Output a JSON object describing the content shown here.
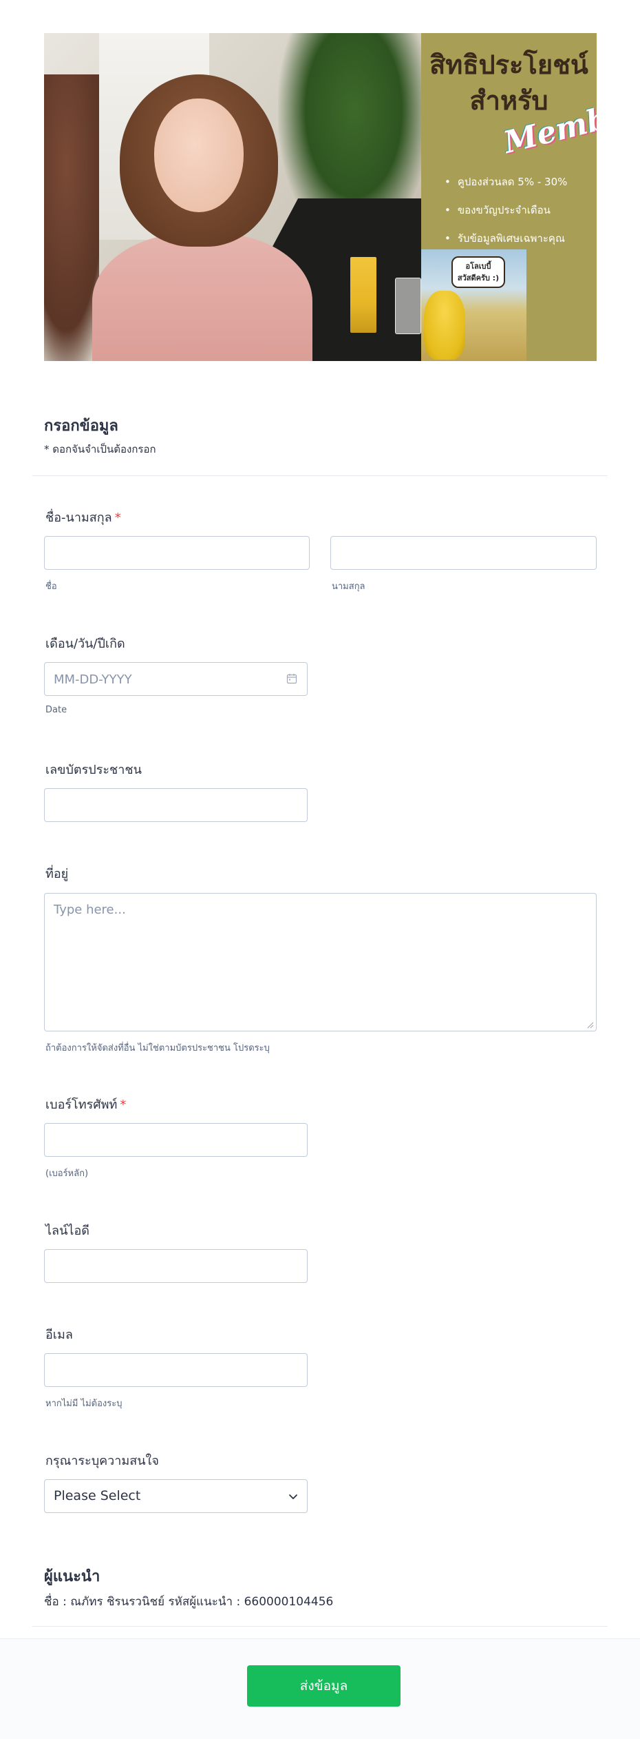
{
  "banner": {
    "title_line1": "สิทธิประโยชน์",
    "title_line2": "สำหรับ",
    "member_word": "Member",
    "benefits": [
      "คูปองส่วนลด 5% - 30%",
      "ของขวัญประจำเดือน",
      "รับข้อมูลพิเศษเฉพาะคุณ"
    ],
    "bubble_line1": "อโลเบบี้",
    "bubble_line2": "สวัสดีครับ :)"
  },
  "header": {
    "title": "กรอกข้อมูล",
    "subtitle": "* ดอกจันจำเป็นต้องกรอก"
  },
  "fields": {
    "name": {
      "label": "ชื่อ-นามสกุล",
      "required_mark": "*",
      "first_sublabel": "ชื่อ",
      "last_sublabel": "นามสกุล",
      "first_value": "",
      "last_value": ""
    },
    "birthdate": {
      "label": "เดือน/วัน/ปีเกิด",
      "placeholder": "MM-DD-YYYY",
      "sublabel": "Date"
    },
    "id_card": {
      "label": "เลขบัตรประชาชน",
      "value": ""
    },
    "address": {
      "label": "ที่อยู่",
      "placeholder": "Type here...",
      "sublabel": "ถ้าต้องการให้จัดส่งที่อื่น ไม่ใช่ตามบัตรประชาชน โปรดระบุ"
    },
    "phone": {
      "label": "เบอร์โทรศัพท์",
      "required_mark": "*",
      "sublabel": "(เบอร์หลัก)",
      "value": ""
    },
    "line_id": {
      "label": "ไลน์ไอดี",
      "value": ""
    },
    "email": {
      "label": "อีเมล",
      "sublabel": "หากไม่มี ไม่ต้องระบุ",
      "value": ""
    },
    "interest": {
      "label": "กรุณาระบุความสนใจ",
      "selected": "Please Select"
    }
  },
  "referrer": {
    "title": "ผู้แนะนำ",
    "info": "ชื่อ : ณภัทร ชิรนรวนิชย์ รหัสผู้แนะนำ : 660000104456"
  },
  "footer": {
    "submit_label": "ส่งข้อมูล"
  },
  "colors": {
    "accent_green": "#18bd5b",
    "required_red": "#f23a3c",
    "banner_olive": "#a89e55",
    "text": "#2c3345"
  }
}
